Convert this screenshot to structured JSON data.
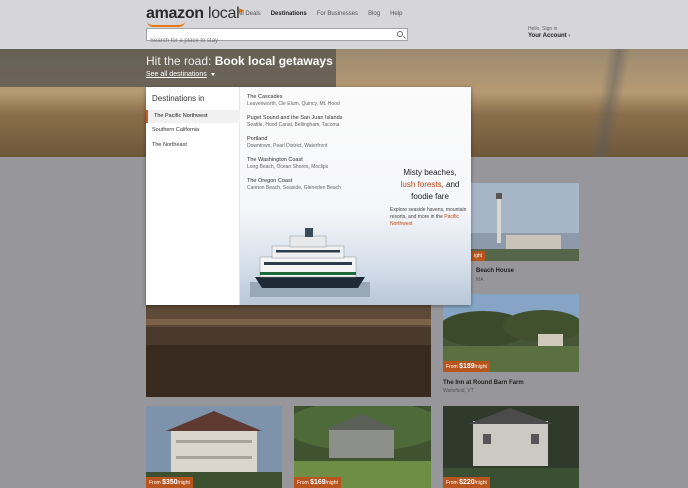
{
  "header": {
    "logo_brand": "amazon",
    "logo_local": "local",
    "nav": [
      "All Deals",
      "Destinations",
      "For Businesses",
      "Blog",
      "Help"
    ],
    "search_placeholder": "Search for a place to stay",
    "greeting": "Hello. Sign in",
    "account": "Your Account"
  },
  "hero": {
    "title_prefix": "Hit the road: ",
    "title_bold": "Book local getaways",
    "see_all": "See all destinations"
  },
  "dropdown": {
    "title": "Destinations in",
    "items": [
      "The Pacific Northwest",
      "Southern California",
      "The Northeast"
    ],
    "regions": [
      {
        "name": "The Cascades",
        "places": "Leavenworth, Cle Elum, Quincy, Mt. Hood"
      },
      {
        "name": "Puget Sound and the San Juan Islands",
        "places": "Seattle, Hood Canal, Bellingham, Tacoma"
      },
      {
        "name": "Portland",
        "places": "Downtown, Pearl District, Waterfront"
      },
      {
        "name": "The Washington Coast",
        "places": "Long Beach, Ocean Shores, Moclips"
      },
      {
        "name": "The Oregon Coast",
        "places": "Cannon Beach, Seaside, Gleneden Beach"
      }
    ],
    "promo": {
      "line1": "Misty beaches,",
      "line2": "lush forests,",
      "line2b": " and",
      "line3": "foodie fare",
      "body": "Explore seaside havens, mountain resorts, and more in the ",
      "link": "Pacific Northwest"
    }
  },
  "cards": [
    {
      "price_prefix": "From ",
      "price": "$189",
      "price_suffix": "/night",
      "title": "The Inn at Round Barn Farm",
      "location": "Waitsfield, VT"
    },
    {
      "price_prefix": "From ",
      "price": "$350",
      "price_suffix": "/night"
    },
    {
      "price_prefix": "From ",
      "price": "$169",
      "price_suffix": "/night"
    },
    {
      "price_prefix": "From ",
      "price": "$220",
      "price_suffix": "/night"
    }
  ],
  "partial_card": {
    "price_fragment": "ight",
    "title_fragment": "Beach House",
    "loc_fragment": "MA"
  },
  "colors": {
    "accent": "#d9531e",
    "price_bg": "#b8541e",
    "overlay": "#97979b"
  }
}
